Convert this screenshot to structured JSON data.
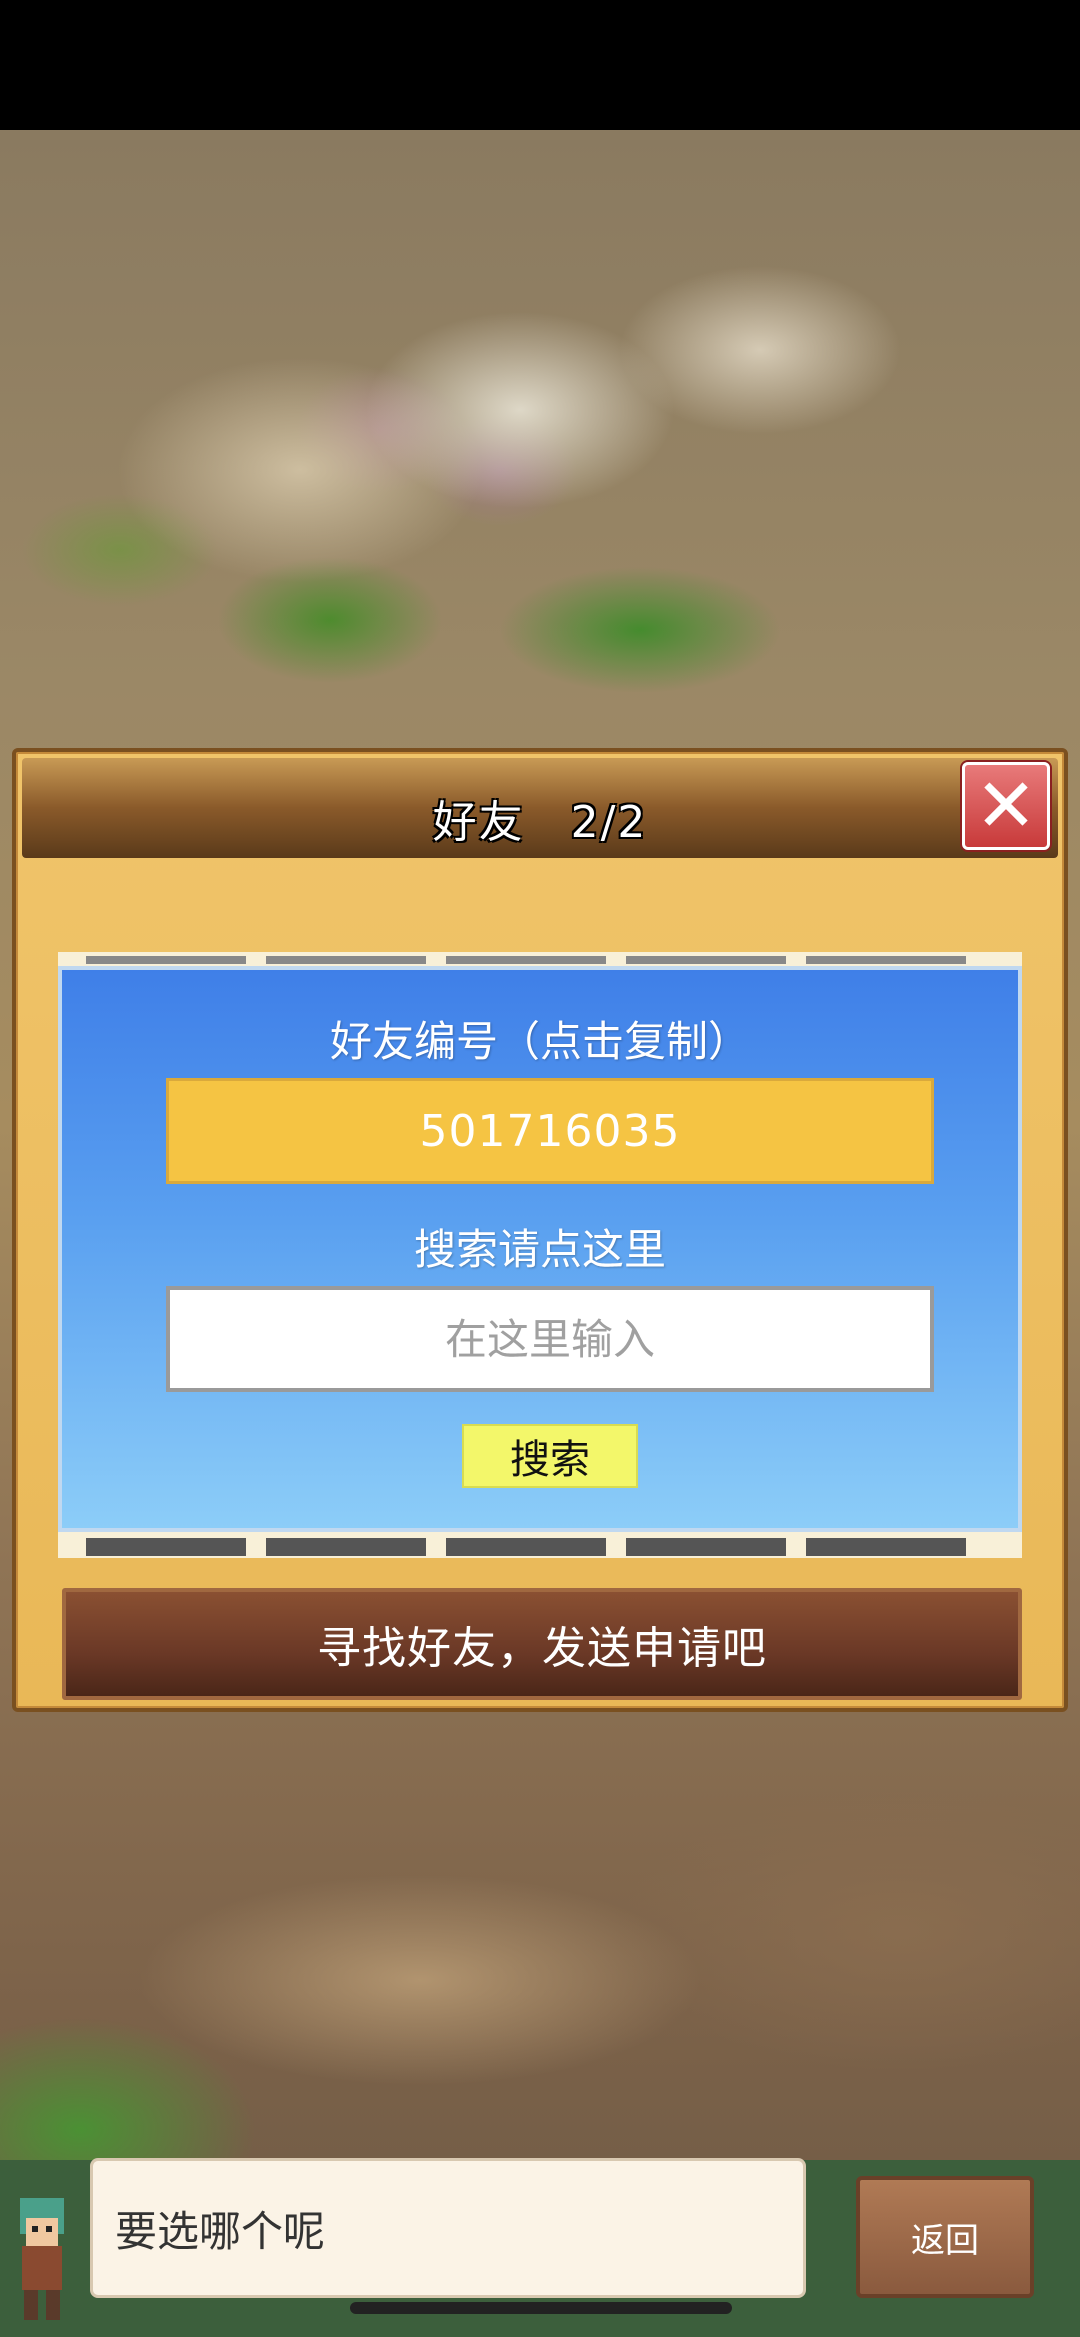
{
  "dialog": {
    "title": "好友　2/2",
    "friend_id_label": "好友编号（点击复制）",
    "friend_id": "501716035",
    "search_label": "搜索请点这里",
    "search_placeholder": "在这里输入",
    "search_button": "搜索",
    "find_friends_prompt": "寻找好友，发送申请吧"
  },
  "footer": {
    "message": "要选哪个呢",
    "back_button": "返回"
  },
  "icons": {
    "close": "close-icon",
    "prev": "arrow-left-icon",
    "next": "arrow-right-icon"
  },
  "colors": {
    "friend_id_bg": "#f5c443",
    "search_button_bg": "#f3f76a",
    "close_button": "#d64a4a",
    "arrow": "#c8e24a"
  }
}
